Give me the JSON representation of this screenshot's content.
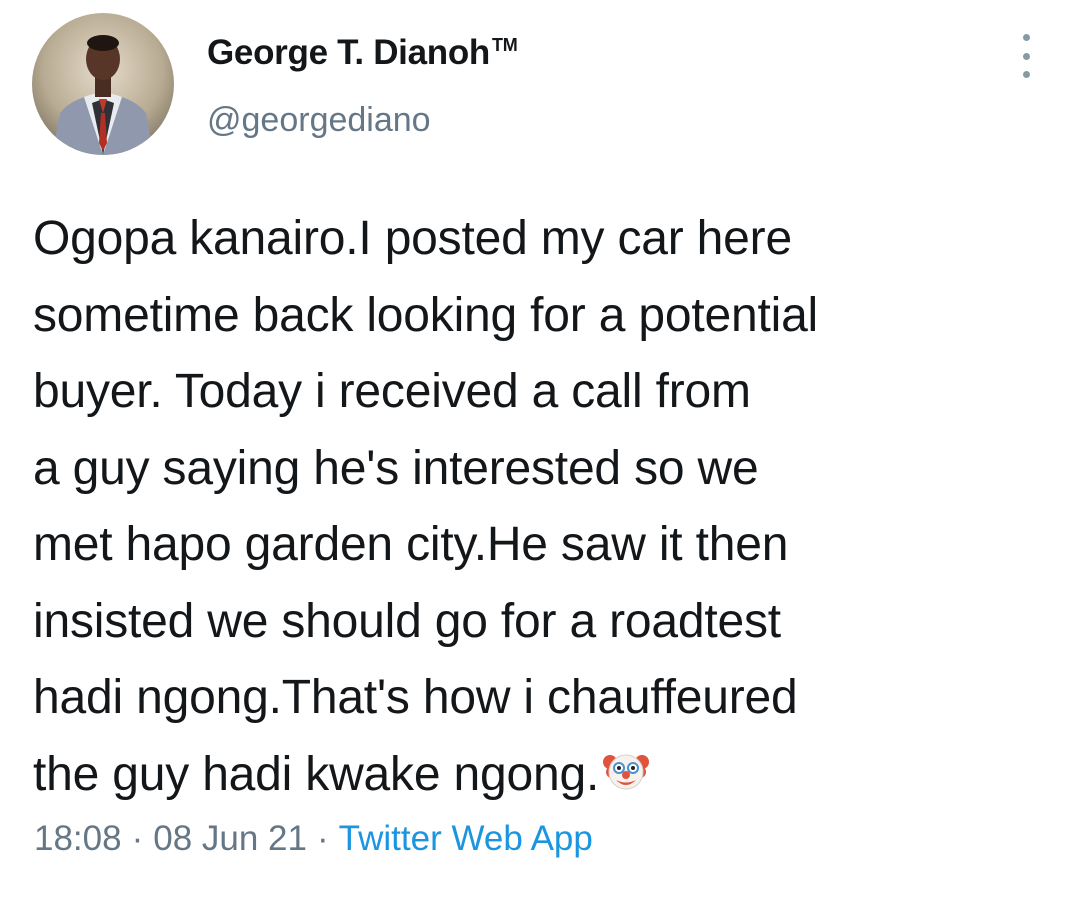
{
  "user": {
    "display_name": "George T. Dianoh",
    "trademark": "TM",
    "handle": "@georgediano",
    "avatar_icon": "profile-photo-man-in-suit"
  },
  "more_menu_icon": "vertical-ellipsis-icon",
  "tweet": {
    "lines": [
      "Ogopa kanairo.I posted my car here",
      "sometime back looking for a potential",
      "buyer. Today i received a call from",
      "a guy saying he's interested so we",
      "met hapo garden city.He saw it then",
      "insisted we should go for a roadtest",
      "hadi ngong.That's how i chauffeured",
      "the guy hadi kwake ngong."
    ],
    "trailing_emoji": "clown-face-emoji"
  },
  "meta": {
    "time": "18:08",
    "date": "08 Jun 21",
    "separator": "·",
    "source": "Twitter Web App"
  },
  "colors": {
    "text": "#14171a",
    "secondary": "#657786",
    "link": "#1b95e0"
  }
}
